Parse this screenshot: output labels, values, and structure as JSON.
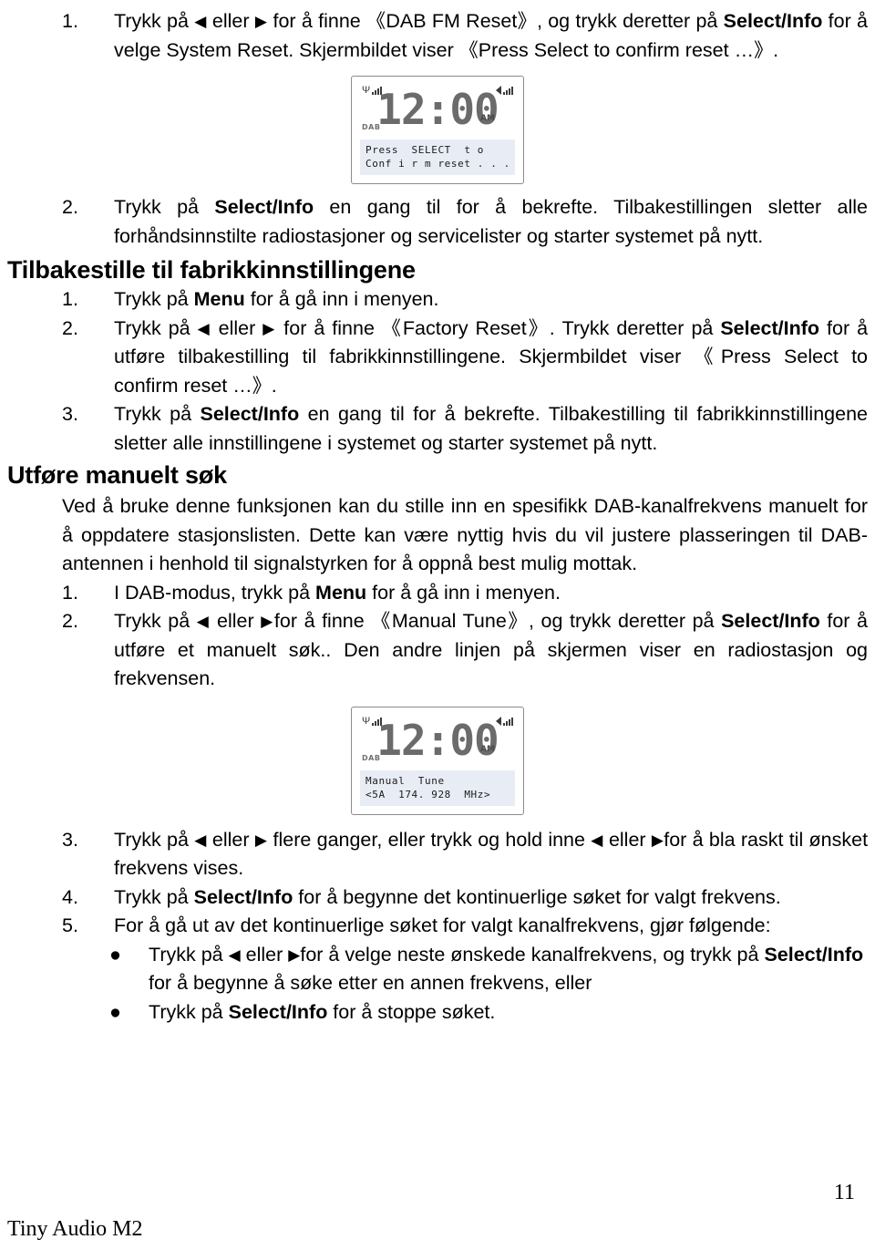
{
  "document": {
    "footer_brand": "Tiny Audio M2",
    "page_number": "11"
  },
  "section_system_reset": {
    "steps": [
      {
        "num": "1.",
        "text_a": "Trykk på ",
        "arrow_left": "◀",
        "text_b": " eller ",
        "arrow_right": "▶",
        "text_c": " for å finne ",
        "quote_open": "《",
        "quoted": "DAB FM Reset",
        "quote_close": "》",
        "text_d": ", og trykk deretter på ",
        "bold_1": "Select/Info",
        "text_e": " for å velge System Reset. Skjermbildet viser ",
        "quote_open_2": "《",
        "quoted_2": "Press Select to confirm reset …",
        "quote_close_2": "》",
        "text_f": "."
      },
      {
        "num": "2.",
        "text_a": "Trykk på ",
        "bold_1": "Select/Info",
        "text_b": " en gang til for å bekrefte. Tilbakestillingen sletter alle forhåndsinnstilte radiostasjoner og servicelister og starter systemet på nytt."
      }
    ]
  },
  "lcd_reset": {
    "time": "12:00",
    "ampm": "AM",
    "band": "DAB",
    "signal_icon": "antenna-signal-icon",
    "volume_icon": "speaker-signal-icon",
    "line_1": "Press  SELECT  t o",
    "line_2": "Conf i r m reset . . ."
  },
  "section_factory_reset": {
    "heading": "Tilbakestille til fabrikkinnstillingene",
    "steps": [
      {
        "num": "1.",
        "text_a": "Trykk på ",
        "bold_1": "Menu",
        "text_b": " for å gå inn i menyen."
      },
      {
        "num": "2.",
        "text_a": "Trykk på ",
        "arrow_left": "◀",
        "text_b": " eller ",
        "arrow_right": "▶",
        "text_c": " for å finne ",
        "quote_open": "《",
        "quoted": "Factory Reset",
        "quote_close": "》",
        "text_d": ". Trykk deretter på ",
        "bold_1": "Select/Info",
        "text_e": " for å utføre tilbakestilling til fabrikkinnstillingene. Skjermbildet viser ",
        "quote_open_2": "《",
        "quoted_2": "Press Select to confirm reset …",
        "quote_close_2": "》",
        "text_f": "."
      },
      {
        "num": "3.",
        "text_a": "Trykk på ",
        "bold_1": "Select/Info",
        "text_b": " en gang til for å bekrefte. Tilbakestilling til fabrikkinnstillingene sletter alle innstillingene i systemet og starter systemet på nytt."
      }
    ]
  },
  "section_manual_search": {
    "heading": "Utføre manuelt søk",
    "intro": "Ved å bruke denne funksjonen kan du stille inn en spesifikk DAB-kanalfrekvens manuelt for å oppdatere stasjonslisten. Dette kan være nyttig hvis du vil justere plasseringen til DAB-antennen i henhold til signalstyrken for å oppnå best mulig mottak.",
    "steps": [
      {
        "num": "1.",
        "text_a": "I DAB-modus, trykk på ",
        "bold_1": "Menu",
        "text_b": " for å gå inn i menyen."
      },
      {
        "num": "2.",
        "text_a": "Trykk på ",
        "arrow_left": "◀",
        "text_b": " eller ",
        "arrow_right": "▶",
        "text_c": "for å finne ",
        "quote_open": "《",
        "quoted": "Manual Tune",
        "quote_close": "》",
        "text_d": ", og trykk deretter på ",
        "bold_1": "Select/Info",
        "text_e": " for å utføre et manuelt søk.. Den andre linjen på skjermen viser en radiostasjon og frekvensen."
      },
      {
        "num": "3.",
        "text_a": "Trykk på ",
        "arrow_left": "◀",
        "text_b": " eller ",
        "arrow_right": "▶",
        "text_c": " flere ganger, eller trykk og hold inne ",
        "arrow_left_2": "◀",
        "text_d": " eller ",
        "arrow_right_2": "▶",
        "text_e": "for å bla raskt til ønsket frekvens vises."
      },
      {
        "num": "4.",
        "text_a": "Trykk på ",
        "bold_1": "Select/Info",
        "text_b": " for å begynne det kontinuerlige søket for valgt frekvens."
      },
      {
        "num": "5.",
        "text_a": "For å gå ut av det kontinuerlige søket for valgt kanalfrekvens, gjør følgende:"
      }
    ],
    "bullets": [
      {
        "marker": "●",
        "text_a": "Trykk på ",
        "arrow_left": "◀",
        "text_b": " eller ",
        "arrow_right": "▶",
        "text_c": "for å velge neste ønskede kanalfrekvens, og trykk på ",
        "bold_1": "Select/Info",
        "text_d": " for å begynne å søke etter en annen frekvens, eller"
      },
      {
        "marker": "●",
        "text_a": "Trykk på ",
        "bold_1": "Select/Info",
        "text_b": " for å stoppe søket."
      }
    ]
  },
  "lcd_manual_tune": {
    "time": "12:00",
    "ampm": "AM",
    "band": "DAB",
    "signal_icon": "antenna-signal-icon",
    "volume_icon": "speaker-signal-icon",
    "line_1": "Manual  Tune",
    "line_2": "<5A  174. 928  MHz>"
  }
}
